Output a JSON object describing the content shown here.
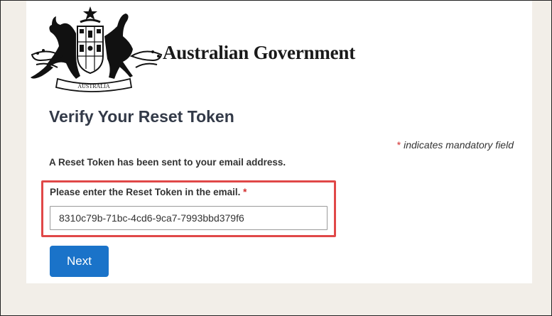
{
  "header": {
    "logo_icon": "commonwealth-coat-of-arms-icon",
    "logo_scroll_text": "AUSTRALIA",
    "government_name": "Australian Government"
  },
  "form": {
    "title": "Verify Your Reset Token",
    "mandatory_asterisk": "*",
    "mandatory_note": "indicates mandatory field",
    "info_text": "A Reset Token has been sent to your email address.",
    "token_label": "Please enter the Reset Token in the email.",
    "token_required_marker": "*",
    "token_value": "8310c79b-71bc-4cd6-9ca7-7993bbd379f6",
    "next_label": "Next"
  },
  "colors": {
    "page_background": "#f2eee8",
    "title_color": "#333a48",
    "required_asterisk": "#d32f2f",
    "highlight_border": "#e04848",
    "primary_button": "#1a73c9"
  }
}
